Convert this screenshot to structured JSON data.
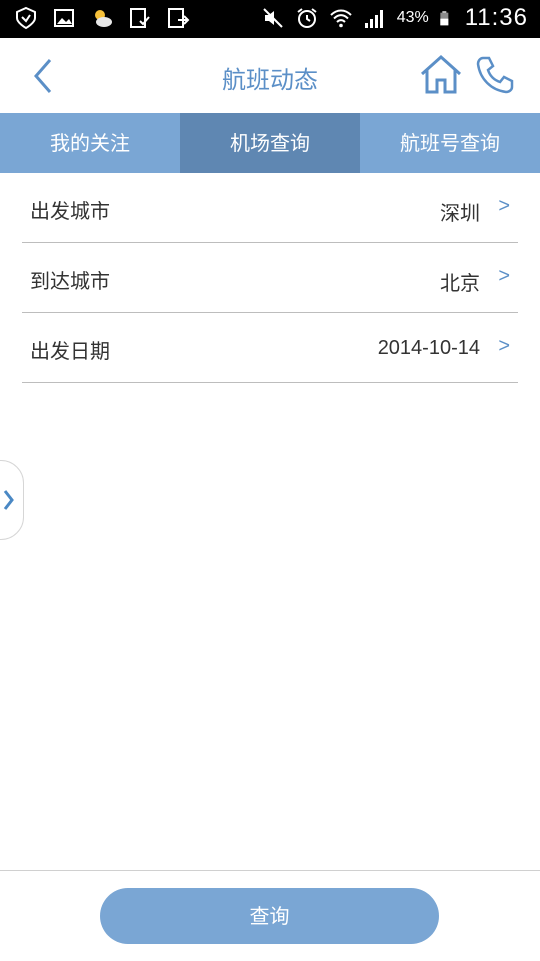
{
  "status_bar": {
    "battery": "43%",
    "time": "11:36",
    "left_icons": [
      "shield-icon",
      "image-icon",
      "weather-icon",
      "clipboard-check-icon",
      "share-icon"
    ],
    "right_icons": [
      "mute-icon",
      "alarm-icon",
      "wifi-icon",
      "signal-icon",
      "battery-icon"
    ]
  },
  "header": {
    "title": "航班动态",
    "back_icon": "chevron-left-icon",
    "home_icon": "home-icon",
    "phone_icon": "phone-icon",
    "accent_color": "#5b8fc7"
  },
  "tabs": [
    {
      "label": "我的关注",
      "active": false
    },
    {
      "label": "机场查询",
      "active": true
    },
    {
      "label": "航班号查询",
      "active": false
    }
  ],
  "form": {
    "rows": [
      {
        "label": "出发城市",
        "value": "深圳",
        "arrow": ">"
      },
      {
        "label": "到达城市",
        "value": "北京",
        "arrow": ">"
      },
      {
        "label": "出发日期",
        "value": "2014-10-14",
        "arrow": ">"
      }
    ]
  },
  "side_handle_icon": "chevron-right-icon",
  "footer": {
    "query_label": "查询",
    "button_color": "#7aa6d4"
  }
}
